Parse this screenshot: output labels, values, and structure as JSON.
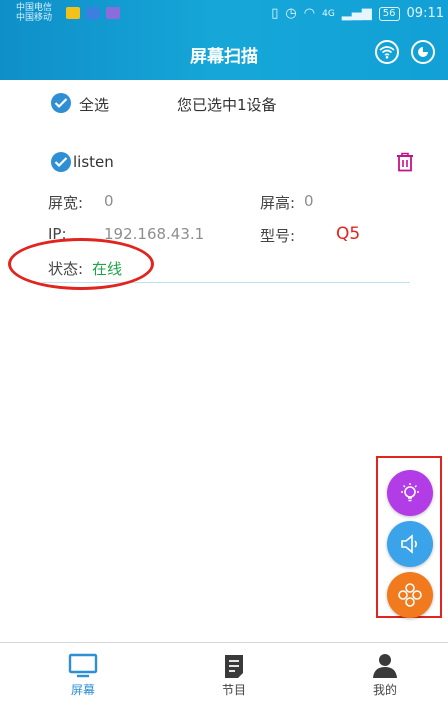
{
  "status_bar": {
    "carrier1": "中国电信",
    "carrier2": "中国移动",
    "network": "4G",
    "battery": "56",
    "time": "09:11"
  },
  "header": {
    "title": "屏幕扫描",
    "icons": [
      "wifi-icon",
      "refresh-icon"
    ]
  },
  "select_all": {
    "label": "全选",
    "summary": "您已选中1设备"
  },
  "device": {
    "name": "listen",
    "width_label": "屏宽:",
    "width_value": "0",
    "height_label": "屏高:",
    "height_value": "0",
    "ip_label": "IP:",
    "ip_value": "192.168.43.1",
    "model_label": "型号:",
    "model_value": "Q5",
    "status_label": "状态:",
    "status_value": "在线"
  },
  "fab_colors": {
    "light": "#b23de6",
    "volume": "#3aa3ea",
    "network": "#f27a1e"
  },
  "tabs": [
    {
      "label": "屏幕",
      "icon": "monitor-icon",
      "active": true
    },
    {
      "label": "节目",
      "icon": "program-icon",
      "active": false
    },
    {
      "label": "我的",
      "icon": "user-icon",
      "active": false
    }
  ]
}
